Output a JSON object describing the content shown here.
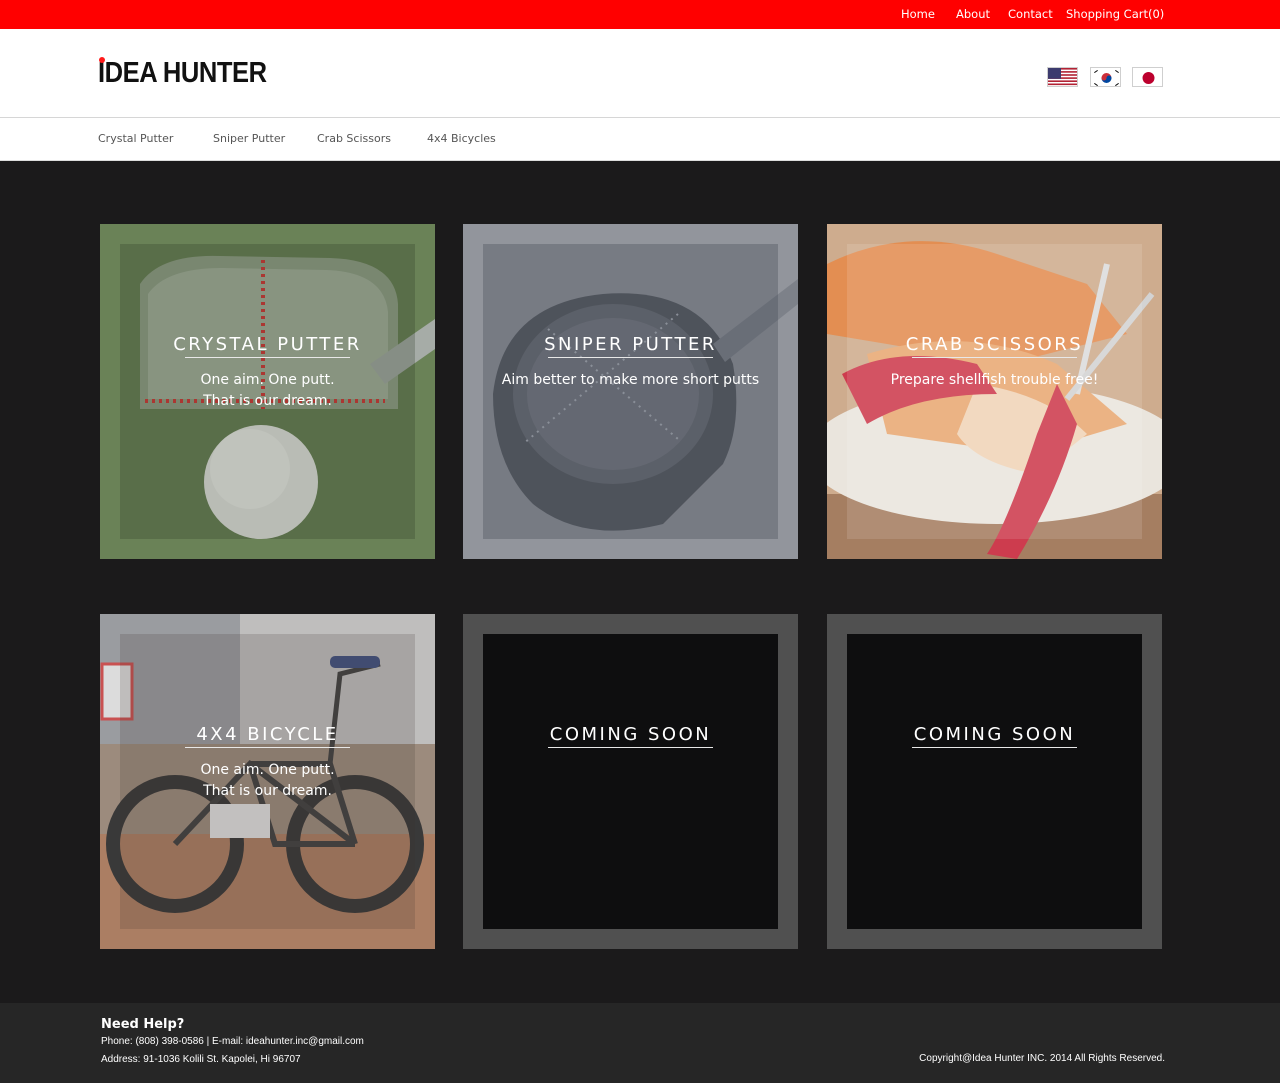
{
  "topbar": {
    "links": [
      "Home",
      "About",
      "Contact",
      "Shopping Cart(0)"
    ]
  },
  "header": {
    "logo_text": "IDEA HUNTER",
    "flags": [
      "us-flag-icon",
      "korea-flag-icon",
      "japan-flag-icon"
    ]
  },
  "nav": {
    "items": [
      "Crystal Putter",
      "Sniper Putter",
      "Crab Scissors",
      "4x4 Bicycles"
    ]
  },
  "tiles": [
    {
      "title": "CRYSTAL PUTTER",
      "subtitle": "One aim. One putt.\nThat is our dream."
    },
    {
      "title": "SNIPER PUTTER",
      "subtitle": "Aim better to make more short putts"
    },
    {
      "title": "CRAB SCISSORS",
      "subtitle": "Prepare shellfish trouble free!"
    },
    {
      "title": "4X4 BICYCLE",
      "subtitle": "One aim. One putt.\nThat is our dream."
    },
    {
      "title": "COMING SOON",
      "subtitle": ""
    },
    {
      "title": "COMING SOON",
      "subtitle": ""
    }
  ],
  "footer": {
    "help_title": "Need Help?",
    "contact_line": "Phone: (808) 398-0586 | E-mail: ideahunter.inc@gmail.com",
    "address_line": "Address: 91-1036 Kolili St. Kapolei, Hi 96707",
    "copyright": "Copyright@Idea Hunter INC. 2014  All Rights Reserved."
  },
  "colors": {
    "topbar": "#ff0000",
    "main_bg": "#1b1a1b",
    "footer_bg": "#262626"
  }
}
